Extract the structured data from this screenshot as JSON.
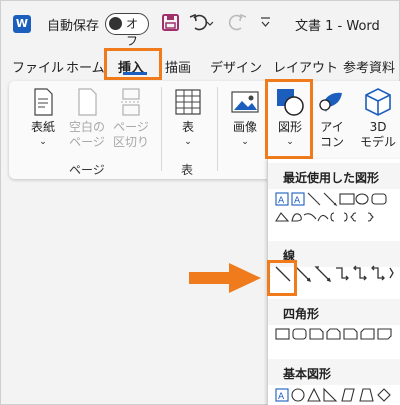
{
  "titlebar": {
    "app_letter": "W",
    "autosave_label": "自動保存",
    "autosave_state": "オフ",
    "document_title": "文書 1  -  Word"
  },
  "tabs": [
    "ファイル",
    "ホーム",
    "挿入",
    "描画",
    "デザイン",
    "レイアウト",
    "参考資料"
  ],
  "active_tab": "挿入",
  "ribbon": {
    "items": {
      "cover": "表紙",
      "blank_page_1": "空白の",
      "blank_page_2": "ページ",
      "page_break_1": "ページ",
      "page_break_2": "区切り",
      "table": "表",
      "pictures": "画像",
      "shapes": "図形",
      "icons_1": "アイ",
      "icons_2": "コン",
      "model_1": "3D",
      "model_2": "モデル"
    },
    "groups": {
      "pages": "ページ",
      "tables": "表"
    }
  },
  "shapes_gallery": {
    "sections": [
      "最近使用した図形",
      "線",
      "四角形",
      "基本図形"
    ]
  },
  "colors": {
    "accent": "#1b5ebe",
    "highlight": "#f07b1d"
  }
}
